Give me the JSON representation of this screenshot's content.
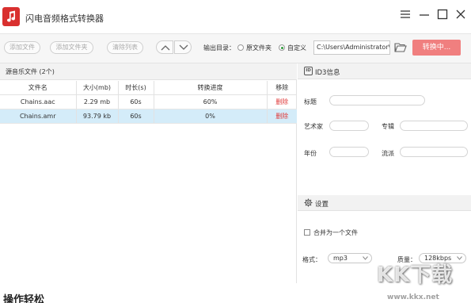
{
  "app": {
    "title": "闪电音频格式转换器"
  },
  "toolbar": {
    "add_file": "添加文件",
    "add_folder": "添加文件夹",
    "clear_list": "清除列表",
    "output_dir_label": "输出目录：",
    "option_source": "原文件夹",
    "option_custom": "自定义",
    "output_path": "C:\\Users\\Administrator\\",
    "convert_button": "转换中..."
  },
  "files": {
    "header": "源音乐文件 (2个)",
    "columns": [
      "文件名",
      "大小(mb)",
      "时长(s)",
      "转换进度",
      "移除"
    ],
    "rows": [
      {
        "name": "Chains.aac",
        "size": "2.29 mb",
        "duration": "60s",
        "progress": "60%",
        "action": "删除",
        "selected": false
      },
      {
        "name": "Chains.amr",
        "size": "93.79 kb",
        "duration": "60s",
        "progress": "0%",
        "action": "删除",
        "selected": true
      }
    ]
  },
  "id3": {
    "badge": "ID",
    "header": "ID3信息",
    "title_label": "标题",
    "artist_label": "艺术家",
    "album_label": "专辑",
    "year_label": "年份",
    "genre_label": "流派"
  },
  "settings": {
    "header": "设置",
    "merge_label": "合并为一个文件",
    "format_label": "格式：",
    "format_value": "mp3",
    "quality_label": "质量：",
    "quality_value": "128kbps"
  },
  "page": {
    "bottom_heading": "操作轻松"
  },
  "watermark": {
    "logo": "KK下载",
    "url": "www.kkx.net"
  },
  "colors": {
    "accent": "#f07f7f",
    "logo": "#d9302f",
    "delete": "#e03b3b",
    "selected_row": "#d4ecf9",
    "radio_on": "#2e9b3a"
  }
}
